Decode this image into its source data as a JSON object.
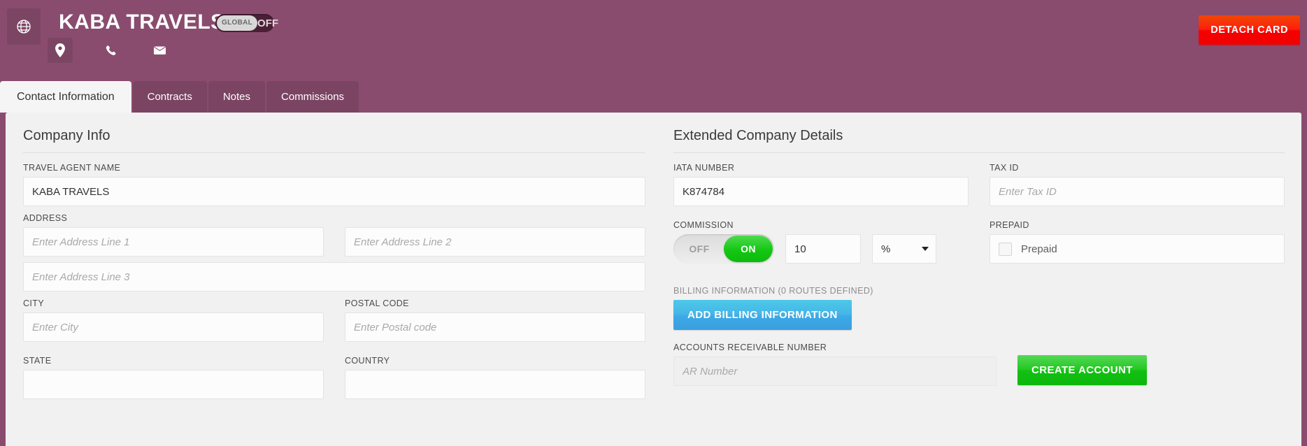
{
  "header": {
    "globe_icon": "globe-icon",
    "company_title": "KABA TRAVELS",
    "global_toggle": {
      "knob_label": "GLOBAL",
      "state_label": "OFF"
    },
    "icons": [
      {
        "name": "location-pin-icon",
        "boxed": true
      },
      {
        "name": "phone-icon",
        "boxed": false
      },
      {
        "name": "envelope-icon",
        "boxed": false
      }
    ],
    "detach_card_label": "DETACH CARD",
    "bg_color": "#8a4c6e",
    "detach_color": "#f40000"
  },
  "tabs": [
    {
      "label": "Contact Information",
      "active": true
    },
    {
      "label": "Contracts",
      "active": false
    },
    {
      "label": "Notes",
      "active": false
    },
    {
      "label": "Commissions",
      "active": false
    }
  ],
  "company_info": {
    "section_title": "Company Info",
    "travel_agent_name": {
      "label": "TRAVEL AGENT NAME",
      "value": "KABA TRAVELS",
      "placeholder": ""
    },
    "address": {
      "label": "ADDRESS",
      "line1_placeholder": "Enter Address Line 1",
      "line1_value": "",
      "line2_placeholder": "Enter Address Line 2",
      "line2_value": "",
      "line3_placeholder": "Enter Address Line 3",
      "line3_value": ""
    },
    "city": {
      "label": "CITY",
      "placeholder": "Enter City",
      "value": ""
    },
    "postal_code": {
      "label": "POSTAL CODE",
      "placeholder": "Enter Postal code",
      "value": ""
    },
    "state": {
      "label": "STATE",
      "placeholder": "",
      "value": ""
    },
    "country": {
      "label": "COUNTRY",
      "placeholder": "",
      "value": ""
    }
  },
  "extended_details": {
    "section_title": "Extended Company Details",
    "iata_number": {
      "label": "IATA NUMBER",
      "value": "K874784",
      "placeholder": ""
    },
    "tax_id": {
      "label": "TAX ID",
      "value": "",
      "placeholder": "Enter Tax ID"
    },
    "commission": {
      "label": "COMMISSION",
      "off_label": "OFF",
      "on_label": "ON",
      "state": "ON",
      "value": "10",
      "unit": "%",
      "on_color": "#14c714"
    },
    "prepaid": {
      "label": "PREPAID",
      "checkbox_label": "Prepaid",
      "checked": false
    },
    "billing": {
      "label": "BILLING INFORMATION (0 ROUTES DEFINED)",
      "add_button_label": "ADD BILLING INFORMATION",
      "add_button_color": "#3da9e6"
    },
    "accounts_receivable": {
      "label": "ACCOUNTS RECEIVABLE NUMBER",
      "placeholder": "AR Number",
      "value": ""
    },
    "create_account_label": "CREATE ACCOUNT",
    "create_account_color": "#12c012"
  }
}
